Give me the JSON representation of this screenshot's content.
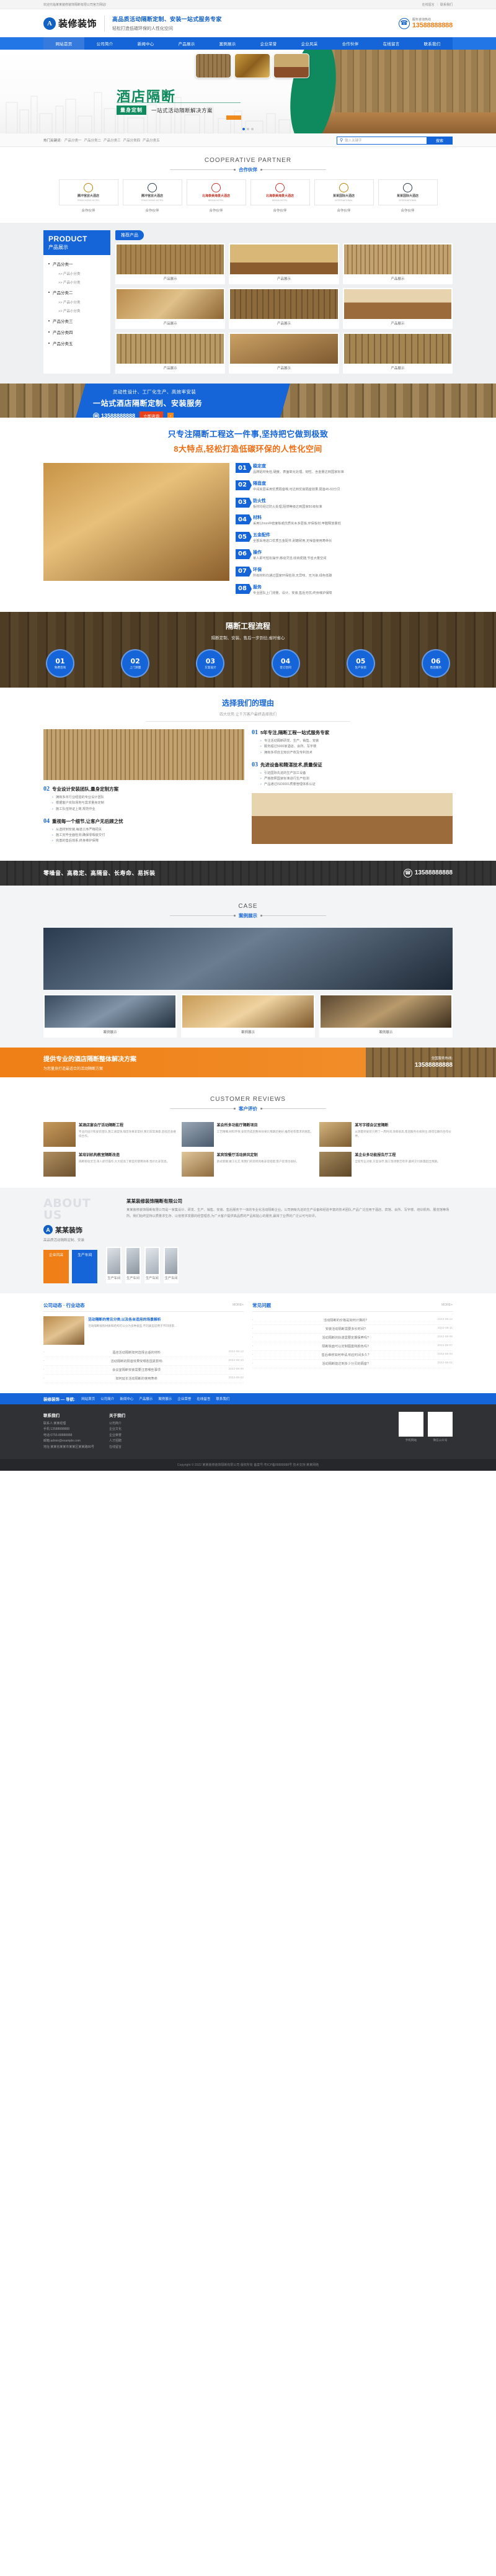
{
  "topbar": {
    "welcome": "欢迎光临某某装修装饰隔断有限公司官方网站!",
    "links": [
      {
        "label": "在线留言"
      },
      {
        "label": "联系我们"
      }
    ],
    "separator": "|"
  },
  "header": {
    "logo_mark": "A",
    "logo_text": "装修装饰",
    "slogan_main": "高品质活动隔断定制、安装一站式服务专家",
    "slogan_sub": "轻松打造低碳环保的人性化空间",
    "phone_icon": "phone-icon",
    "phone_label": "服务咨询热线",
    "phone_number": "13588888888"
  },
  "nav": {
    "items": [
      {
        "label": "网站首页",
        "active": true
      },
      {
        "label": "公司简介",
        "active": false
      },
      {
        "label": "新闻中心",
        "active": false
      },
      {
        "label": "产品展示",
        "active": false
      },
      {
        "label": "案例展示",
        "active": false
      },
      {
        "label": "企业荣誉",
        "active": false
      },
      {
        "label": "企业风采",
        "active": false
      },
      {
        "label": "合作伙伴",
        "active": false
      },
      {
        "label": "在线留言",
        "active": false
      },
      {
        "label": "联系我们",
        "active": false
      }
    ]
  },
  "hero": {
    "title": "酒店隔断",
    "badge": "量身定制",
    "subtitle": "一站式活动隔断解决方案",
    "accent_color": "#0f8a5f",
    "dots": 3,
    "active_dot": 0
  },
  "search": {
    "keywords_label": "热门关键词:",
    "keywords": [
      "产品分类一",
      "产品分类二",
      "产品分类三",
      "产品分类四",
      "产品分类五"
    ],
    "placeholder": "输入关键字",
    "search_icon": "search-icon",
    "button_label": "搜索"
  },
  "partners": {
    "title_en": "COOPERATIVE PARTNER",
    "title_cn": "合作伙伴",
    "items": [
      {
        "name": "腾冲官房大酒店",
        "sub": "TENGCHONG HOTEL",
        "caption": "合作伙伴"
      },
      {
        "name": "腾冲官房大酒店",
        "sub": "TENGCHONG HOTEL",
        "caption": "合作伙伴"
      },
      {
        "name": "北海泰美海景大酒店",
        "sub": "BEIHAI HOTEL",
        "caption": "合作伙伴"
      },
      {
        "name": "北海泰美海景大酒店",
        "sub": "BEIHAI HOTEL",
        "caption": "合作伙伴"
      },
      {
        "name": "某某国际大酒店",
        "sub": "INTERNATIONAL",
        "caption": "合作伙伴"
      },
      {
        "name": "某某国际大酒店",
        "sub": "INTERNATIONAL",
        "caption": "合作伙伴"
      }
    ]
  },
  "product": {
    "sidebar": {
      "title_en": "PRODUCT",
      "title_cn": "产品展示",
      "categories": [
        {
          "label": "产品分类一",
          "subs": [
            "产品小分类",
            "产品小分类"
          ]
        },
        {
          "label": "产品分类二",
          "subs": [
            "产品小分类",
            "产品小分类"
          ]
        },
        {
          "label": "产品分类三",
          "subs": []
        },
        {
          "label": "产品分类四",
          "subs": []
        },
        {
          "label": "产品分类五",
          "subs": []
        }
      ]
    },
    "tab_label": "推荐产品",
    "items": [
      {
        "caption": "产品展示"
      },
      {
        "caption": "产品展示"
      },
      {
        "caption": "产品展示"
      },
      {
        "caption": "产品展示"
      },
      {
        "caption": "产品展示"
      },
      {
        "caption": "产品展示"
      },
      {
        "caption": "产品展示"
      },
      {
        "caption": "产品展示"
      },
      {
        "caption": "产品展示"
      }
    ]
  },
  "cta1": {
    "line1": "灵动性设计、工厂化生产、高效率安装",
    "line2": "一站式酒店隔断定制、安装服务",
    "phone_icon": "phone-icon",
    "phone": "13588888888",
    "button": "立即咨询",
    "arrow": "›"
  },
  "features": {
    "heading1": "只专注隔断工程这一件事,坚持把它做到极致",
    "heading2": "8大特点,轻松打造低碳环保的人性化空间",
    "items": [
      {
        "num": "01",
        "title": "稳定度",
        "desc": "品牌铝材免检,硬度、表面氧化处理、韧性、含金量达到国家标准"
      },
      {
        "num": "02",
        "title": "隔音度",
        "desc": "中间夹层采用优质隔音棉,可达到优良隔音效果,隔音45-53分贝"
      },
      {
        "num": "03",
        "title": "防火性",
        "desc": "板材均经过防火处理,阻燃等级达到国家B1级标准"
      },
      {
        "num": "04",
        "title": "材料",
        "desc": "采用12mm中密度板或优质实木多层板,环保板材,甲醛释放量低"
      },
      {
        "num": "05",
        "title": "五金配件",
        "desc": "全部采用进口优质五金配件,耐磨耐用,无噪音使用寿命长"
      },
      {
        "num": "06",
        "title": "操作",
        "desc": "单人即可轻松操作,移动灵活,收纳便捷,节省大量空间"
      },
      {
        "num": "07",
        "title": "环保",
        "desc": "所有材料均通过国家环保检测,无异味、无污染,绿色低碳"
      },
      {
        "num": "08",
        "title": "服务",
        "desc": "专业团队上门测量、设计、安装,售后无忧,终身维护保障"
      }
    ]
  },
  "process": {
    "title": "隔断工程流程",
    "subtitle": "隔断定制、安装、售后一步到位,省时省心",
    "steps": [
      {
        "num": "01",
        "label": "免费咨询"
      },
      {
        "num": "02",
        "label": "上门测量"
      },
      {
        "num": "03",
        "label": "方案设计"
      },
      {
        "num": "04",
        "label": "签订合同"
      },
      {
        "num": "05",
        "label": "生产安装"
      },
      {
        "num": "06",
        "label": "售后服务"
      }
    ]
  },
  "reasons": {
    "title": "选择我们的理由",
    "subtitle": "四大优势,让千万客户最终选择我们",
    "left_blocks": [
      {
        "mark": "02",
        "title": "专业设计安装团队,量身定制方案",
        "points": [
          "拥有多年行业经验的专业设计团队",
          "根据客户实际场地与需求量身定制",
          "施工队伍持证上岗,规范作业"
        ]
      },
      {
        "mark": "04",
        "title": "重视每一个细节,让客户无后顾之忧",
        "points": [
          "从选材到安装,每道工序严格把关",
          "施工完毕全面检测,确保零瑕疵交付",
          "完善的售后体系,终身维护保障"
        ]
      }
    ],
    "right_blocks": [
      {
        "mark": "01",
        "title": "5年专注,隔断工程一站式服务专家",
        "points": [
          "专注活动隔断研发、生产、销售、安装",
          "服务超过5000家酒店、会所、写字楼",
          "拥有多项自主知识产权及专利技术"
        ]
      },
      {
        "mark": "03",
        "title": "先进设备和精湛技术,质量保证",
        "points": [
          "引进国际先进的生产加工设备",
          "严格按照国家标准进行生产检测",
          "产品通过ISO9001质量管理体系认证"
        ]
      }
    ]
  },
  "cta2": {
    "text": "零噪音、高稳定、高隔音、长寿命、易拆装",
    "phone_icon": "phone-icon",
    "phone": "13588888888"
  },
  "cases": {
    "title_en": "CASE",
    "title_cn": "案例展示",
    "items": [
      {
        "caption": "案例展示"
      },
      {
        "caption": "案例展示"
      },
      {
        "caption": "案例展示"
      }
    ]
  },
  "cta3": {
    "title": "提供专业的酒店隔断整体解决方案",
    "sub": "为您量身打造最适合的活动隔断方案",
    "label": "全国服务热线:",
    "phone": "13588888888"
  },
  "testimonials": {
    "title_en": "CUSTOMER REVIEWS",
    "title_cn": "客户评价",
    "items": [
      {
        "title": "某酒店宴会厅活动隔断工程",
        "body": "专业的设计和安装团队,施工速度快,隔音效果非常好,我们非常满意,后续还会继续合作。"
      },
      {
        "title": "某会所多功能厅隔断项目",
        "body": "工艺精细,材料环保,安装完成后整体效果比预期还要好,推荐给有需求的朋友。"
      },
      {
        "title": "某写字楼会议室隔断",
        "body": "从测量到安装只用了一周时间,效率很高,售后服务也很到位,值得信赖的合作伙伴。"
      },
      {
        "title": "某培训机构教室隔断改造",
        "body": "隔断移动灵活,单人即可操作,大大提高了教室的使用效率,性价比非常高。"
      },
      {
        "title": "某宾馆餐厅活动屏风定制",
        "body": "款式新颖,做工扎实,和我们的装修风格非常搭配,客户反馈也很好。"
      },
      {
        "title": "某企业多功能报告厅工程",
        "body": "全程专业对接,方案详尽,施工现场整洁有序,最终交付质量超出预期。"
      }
    ]
  },
  "about": {
    "ghost_line1": "ABOUT",
    "ghost_line2": "US",
    "logo_mark": "A",
    "logo_text": "某某装饰",
    "logo_sub": "高品质活动隔断定制、安装",
    "title": "某某装修装饰隔断有限公司",
    "body": "某某装修装饰隔断有限公司是一家集设计、研发、生产、销售、安装、售后服务于一体的专业化活动隔断企业。公司拥有先进的生产设备和经验丰富的技术团队,产品广泛应用于酒店、宾馆、会所、写字楼、培训机构、展览馆等场所。我们始终坚持以质量求生存、以信誉求发展的经营理念,为广大客户提供高品质的产品和贴心的服务,赢得了业界的广泛认可与好评。",
    "tabs": [
      {
        "label": "企业风采",
        "accent": true
      },
      {
        "label": "生产车间",
        "accent": false
      }
    ],
    "gallery": [
      {
        "caption": "生产车间"
      },
      {
        "caption": "生产车间"
      },
      {
        "caption": "生产车间"
      },
      {
        "caption": "生产车间"
      }
    ]
  },
  "news": {
    "left": {
      "title": "公司动态 · 行业动态",
      "more": "MORE+",
      "feature": {
        "title": "活动隔断的常见分类,以及各自适用的场景解析",
        "desc": "活动隔断按照材质和结构可以分为多种类型,不同类型适用于不同场景..."
      },
      "list": [
        {
          "text": "酒店活动隔断如何选择合适的材料",
          "date": "2022-08-12"
        },
        {
          "text": "活动隔断的隔音效果受哪些因素影响",
          "date": "2022-08-10"
        },
        {
          "text": "会议室隔断安装需要注意哪些事项",
          "date": "2022-08-06"
        },
        {
          "text": "如何延长活动隔断的使用寿命",
          "date": "2022-08-02"
        }
      ]
    },
    "right": {
      "title": "常见问题",
      "more": "MORE+",
      "list": [
        {
          "text": "活动隔断的价格是如何计算的?",
          "date": "2022-08-12"
        },
        {
          "text": "安装活动隔断需要多长时间?",
          "date": "2022-08-11"
        },
        {
          "text": "活动隔断的轨道需要定期保养吗?",
          "date": "2022-08-09"
        },
        {
          "text": "隔断板面可以定制图案和颜色吗?",
          "date": "2022-08-07"
        },
        {
          "text": "售后维修如何申请,响应时间多久?",
          "date": "2022-08-03"
        },
        {
          "text": "活动隔断能达到多少分贝的隔音?",
          "date": "2022-08-01"
        }
      ]
    }
  },
  "footer": {
    "nav_brand": "装修装饰 — 导航:",
    "nav_links": [
      "网站首页",
      "公司简介",
      "新闻中心",
      "产品展示",
      "案例展示",
      "企业荣誉",
      "在线留言",
      "联系我们"
    ],
    "columns": [
      {
        "heading": "联系我们",
        "lines": [
          "联系人:某某经理",
          "手机:13588888888",
          "电话:0755-88888888",
          "邮箱:admin@example.com",
          "地址:某某省某某市某某区某某路88号"
        ]
      },
      {
        "heading": "关于我们",
        "lines": [
          "公司简介",
          "企业文化",
          "企业荣誉",
          "人才招聘",
          "在线留言"
        ]
      }
    ],
    "qrcodes": [
      {
        "caption": "手机网站"
      },
      {
        "caption": "微信公众号"
      }
    ],
    "copyright": "Copyright © 2022 某某装修装饰隔断有限公司 版权所有  备案号:粤ICP备88888888号   技术支持:某某网络"
  }
}
